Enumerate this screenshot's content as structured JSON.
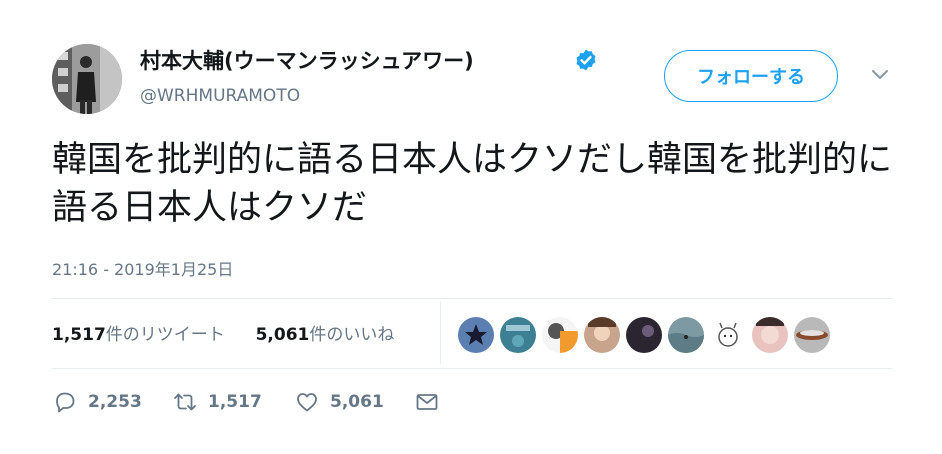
{
  "author": {
    "display_name": "村本大輔(ウーマンラッシュアワー)",
    "handle": "@WRHMURAMOTO",
    "verified_icon": "verified-badge-icon",
    "avatar": "profile-photo"
  },
  "follow_button": {
    "label": "フォローする"
  },
  "menu_icon": "chevron-down-icon",
  "tweet": {
    "text": "韓国を批判的に語る日本人はクソだし韓国を批判的に語る日本人はクソだ",
    "timestamp": "21:16 - 2019年1月25日"
  },
  "stats": {
    "retweets_count": "1,517",
    "retweets_label": "件のリツイート",
    "likes_count": "5,061",
    "likes_label": "件のいいね"
  },
  "actions": {
    "reply": {
      "icon": "reply-icon",
      "count": "2,253"
    },
    "retweet": {
      "icon": "retweet-icon",
      "count": "1,517"
    },
    "like": {
      "icon": "heart-icon",
      "count": "5,061"
    },
    "message": {
      "icon": "envelope-icon"
    }
  },
  "colors": {
    "accent": "#1da1f2",
    "secondary_text": "#657786",
    "primary_text": "#14171a",
    "divider": "#e6ecf0"
  }
}
